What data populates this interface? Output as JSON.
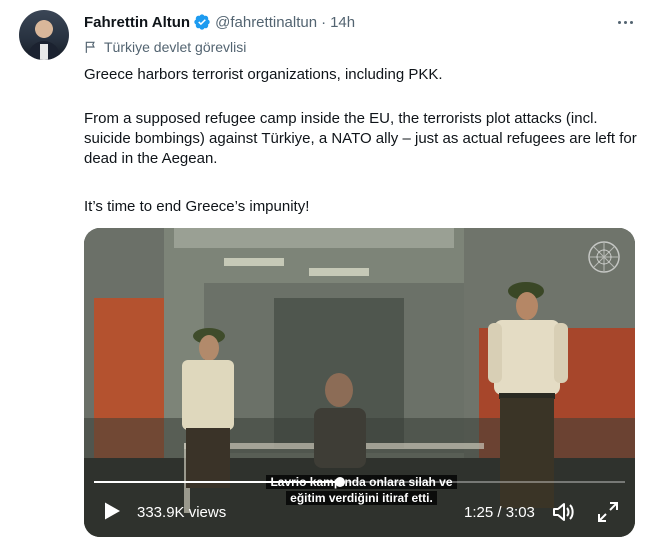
{
  "tweet": {
    "author_name": "Fahrettin Altun",
    "handle": "@fahrettinaltun",
    "separator": "·",
    "time": "14h",
    "affiliation_label": "Türkiye devlet görevlisi",
    "text_1": "Greece harbors terrorist organizations, including PKK.",
    "text_2": "From a supposed refugee camp inside the EU, the terrorists plot attacks (incl. suicide bombings) against Türkiye, a NATO ally – just as actual refugees are left for dead in the Aegean.",
    "text_3": "It’s time to end Greece’s impunity!"
  },
  "video": {
    "subtitle_line_1": "Lavrio kampında onlara silah ve",
    "subtitle_line_2": "eğitim verdiğini itiraf etti.",
    "views": "333.9K views",
    "elapsed": "1:25",
    "duration": "3:03",
    "time_display": "1:25 / 3:03",
    "progress_fraction": 0.464
  },
  "icons": {
    "verified": "verified-badge-icon",
    "more": "more-options-icon",
    "flag": "flag-icon",
    "play": "play-icon",
    "volume": "volume-icon",
    "fullscreen": "fullscreen-icon"
  },
  "colors": {
    "verified_blue": "#1d9bf0",
    "text_primary": "#0f1419",
    "text_secondary": "#536471"
  }
}
